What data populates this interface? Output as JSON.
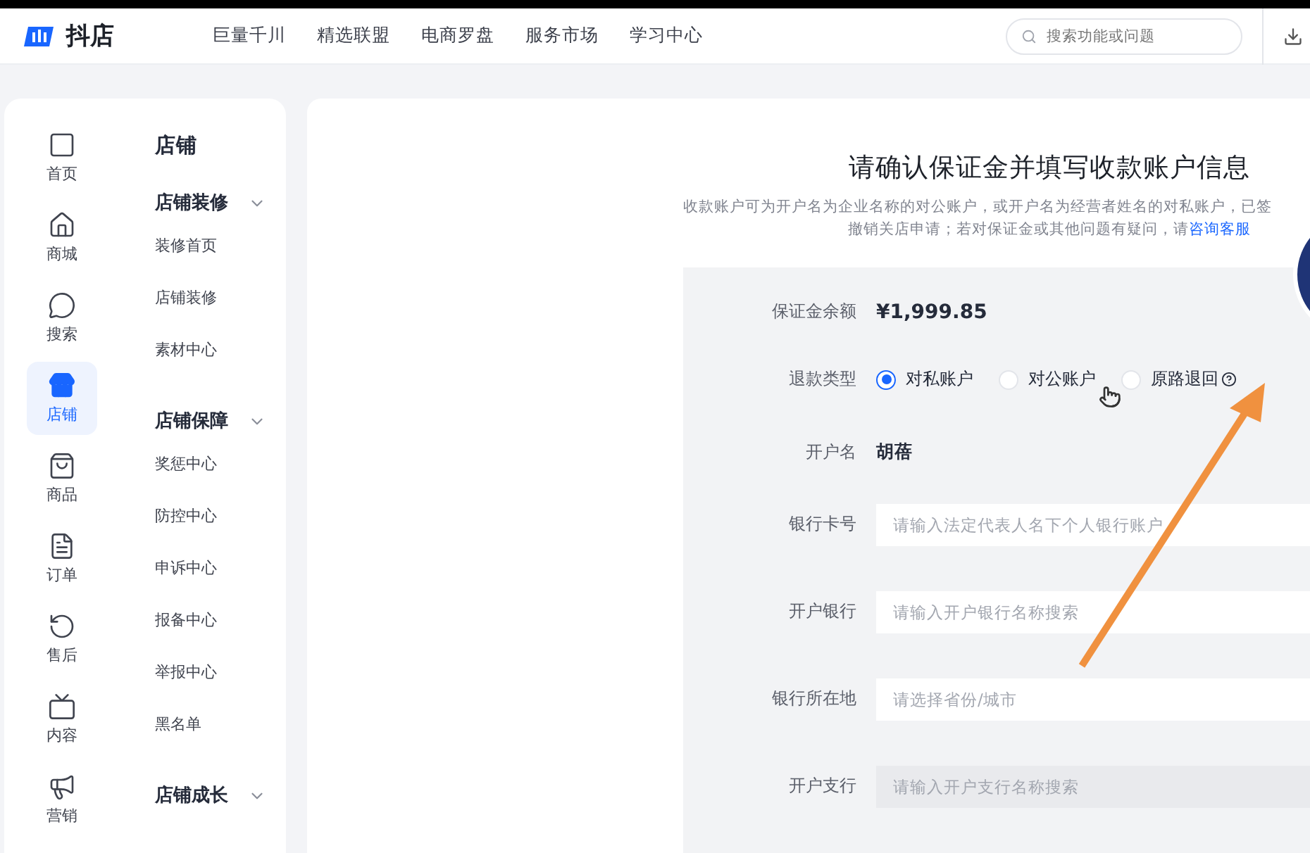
{
  "header": {
    "logo": "抖店",
    "nav": [
      "巨量千川",
      "精选联盟",
      "电商罗盘",
      "服务市场",
      "学习中心"
    ],
    "search": {
      "placeholder": "搜索功能或问题"
    }
  },
  "sidebar": {
    "items": [
      {
        "label": "首页",
        "selected": false
      },
      {
        "label": "商城",
        "selected": false
      },
      {
        "label": "搜索",
        "selected": false
      },
      {
        "label": "店铺",
        "selected": true
      },
      {
        "label": "商品",
        "selected": false
      },
      {
        "label": "订单",
        "selected": false
      },
      {
        "label": "售后",
        "selected": false
      },
      {
        "label": "内容",
        "selected": false
      },
      {
        "label": "营销",
        "selected": false
      }
    ]
  },
  "submenu": {
    "title": "店铺",
    "groups": [
      {
        "title": "店铺装修",
        "expanded": true,
        "items": [
          "装修首页",
          "店铺装修",
          "素材中心"
        ]
      },
      {
        "title": "店铺保障",
        "expanded": true,
        "items": [
          "奖惩中心",
          "防控中心",
          "申诉中心",
          "报备中心",
          "举报中心",
          "黑名单"
        ]
      },
      {
        "title": "店铺成长",
        "expanded": true
      }
    ]
  },
  "page": {
    "title": "请确认保证金并填写收款账户信息",
    "description": [
      "收款账户可为开户名为企业名称的对公账户，或开户名为经营者姓名的对私账户，已签",
      "撤销关店申请；若对保证金或其他问题有疑问，请"
    ],
    "link": "咨询客服"
  },
  "form": {
    "rows": [
      {
        "kind": "amount",
        "label": "保证金余额",
        "value": "¥1,999.85"
      },
      {
        "kind": "radio",
        "label": "退款类型",
        "options": [
          {
            "label": "对私账户",
            "selected": true,
            "help": false
          },
          {
            "label": "对公账户",
            "selected": false,
            "help": false
          },
          {
            "label": "原路退回",
            "selected": false,
            "help": true
          }
        ]
      },
      {
        "kind": "text",
        "label": "开户名",
        "value": "胡蓓"
      },
      {
        "kind": "input",
        "label": "银行卡号",
        "placeholder": "请输入法定代表人名下个人银行账户",
        "disabled": false
      },
      {
        "kind": "input",
        "label": "开户银行",
        "placeholder": "请输入开户银行名称搜索",
        "disabled": false
      },
      {
        "kind": "input",
        "label": "银行所在地",
        "placeholder": "请选择省份/城市",
        "disabled": false
      },
      {
        "kind": "input",
        "label": "开户支行",
        "placeholder": "请输入开户支行名称搜索",
        "disabled": true
      }
    ]
  }
}
